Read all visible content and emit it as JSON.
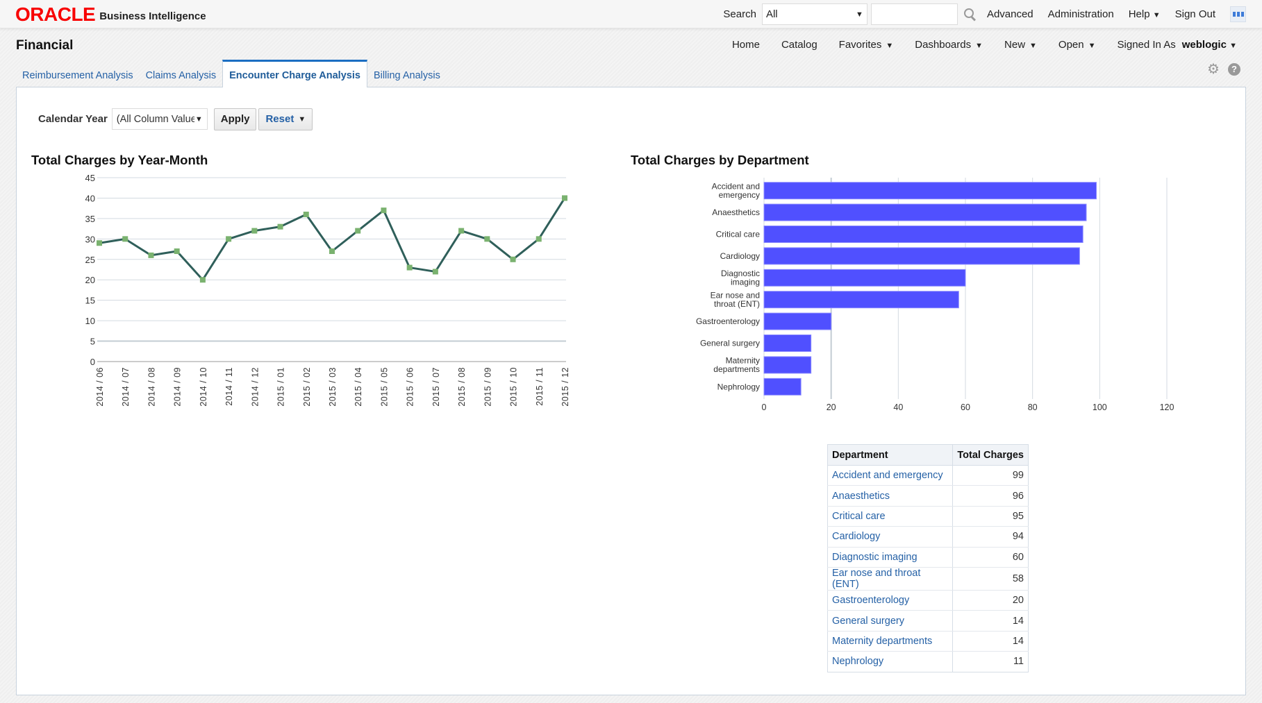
{
  "header": {
    "brand": "ORACLE",
    "product": "Business Intelligence",
    "search_label": "Search",
    "search_scope": "All",
    "search_placeholder": "",
    "links": {
      "advanced": "Advanced",
      "administration": "Administration",
      "help": "Help",
      "sign_out": "Sign Out"
    }
  },
  "nav": {
    "dashboard_title": "Financial",
    "items": {
      "home": "Home",
      "catalog": "Catalog",
      "favorites": "Favorites",
      "dashboards": "Dashboards",
      "new": "New",
      "open": "Open"
    },
    "signed_in_label": "Signed In As",
    "user": "weblogic"
  },
  "tabs": [
    {
      "label": "Reimbursement Analysis",
      "active": false
    },
    {
      "label": "Claims Analysis",
      "active": false
    },
    {
      "label": "Encounter Charge Analysis",
      "active": true
    },
    {
      "label": "Billing Analysis",
      "active": false
    }
  ],
  "prompt": {
    "label": "Calendar Year",
    "value": "(All Column Values)",
    "apply": "Apply",
    "reset": "Reset"
  },
  "colors": {
    "line": "#2f5f5a",
    "marker": "#7ab26f",
    "bar": "#5050ff",
    "link": "#2561a6",
    "accent": "#1b6ec2"
  },
  "chart_data": [
    {
      "type": "line",
      "title": "Total Charges by Year-Month",
      "xlabel": "",
      "ylabel": "",
      "x": [
        "2014 / 06",
        "2014 / 07",
        "2014 / 08",
        "2014 / 09",
        "2014 / 10",
        "2014 / 11",
        "2014 / 12",
        "2015 / 01",
        "2015 / 02",
        "2015 / 03",
        "2015 / 04",
        "2015 / 05",
        "2015 / 06",
        "2015 / 07",
        "2015 / 08",
        "2015 / 09",
        "2015 / 10",
        "2015 / 11",
        "2015 / 12"
      ],
      "series": [
        {
          "name": "Total Charges",
          "values": [
            29,
            30,
            26,
            27,
            20,
            30,
            32,
            33,
            36,
            27,
            32,
            37,
            23,
            22,
            32,
            30,
            25,
            30,
            40
          ]
        }
      ],
      "ylim": [
        0,
        45
      ],
      "yticks": [
        0,
        5,
        10,
        15,
        20,
        25,
        30,
        35,
        40,
        45
      ],
      "grid": true,
      "legend": "none"
    },
    {
      "type": "bar",
      "orientation": "horizontal",
      "title": "Total Charges by Department",
      "categories": [
        "Accident and emergency",
        "Anaesthetics",
        "Critical care",
        "Cardiology",
        "Diagnostic imaging",
        "Ear nose and throat (ENT)",
        "Gastroenterology",
        "General surgery",
        "Maternity departments",
        "Nephrology"
      ],
      "category_labels": [
        [
          "Accident and",
          "emergency"
        ],
        [
          "Anaesthetics"
        ],
        [
          "Critical care"
        ],
        [
          "Cardiology"
        ],
        [
          "Diagnostic",
          "imaging"
        ],
        [
          "Ear nose and",
          "throat (ENT)"
        ],
        [
          "Gastroenterology"
        ],
        [
          "General surgery"
        ],
        [
          "Maternity",
          "departments"
        ],
        [
          "Nephrology"
        ]
      ],
      "values": [
        99,
        96,
        95,
        94,
        60,
        58,
        20,
        14,
        14,
        11
      ],
      "xlim": [
        0,
        120
      ],
      "xticks": [
        0,
        20,
        40,
        60,
        80,
        100,
        120
      ],
      "grid": true,
      "legend": "none"
    }
  ],
  "table": {
    "columns": [
      "Department",
      "Total Charges"
    ],
    "rows": [
      [
        "Accident and emergency",
        "99"
      ],
      [
        "Anaesthetics",
        "96"
      ],
      [
        "Critical care",
        "95"
      ],
      [
        "Cardiology",
        "94"
      ],
      [
        "Diagnostic imaging",
        "60"
      ],
      [
        "Ear nose and throat (ENT)",
        "58"
      ],
      [
        "Gastroenterology",
        "20"
      ],
      [
        "General surgery",
        "14"
      ],
      [
        "Maternity departments",
        "14"
      ],
      [
        "Nephrology",
        "11"
      ]
    ]
  }
}
